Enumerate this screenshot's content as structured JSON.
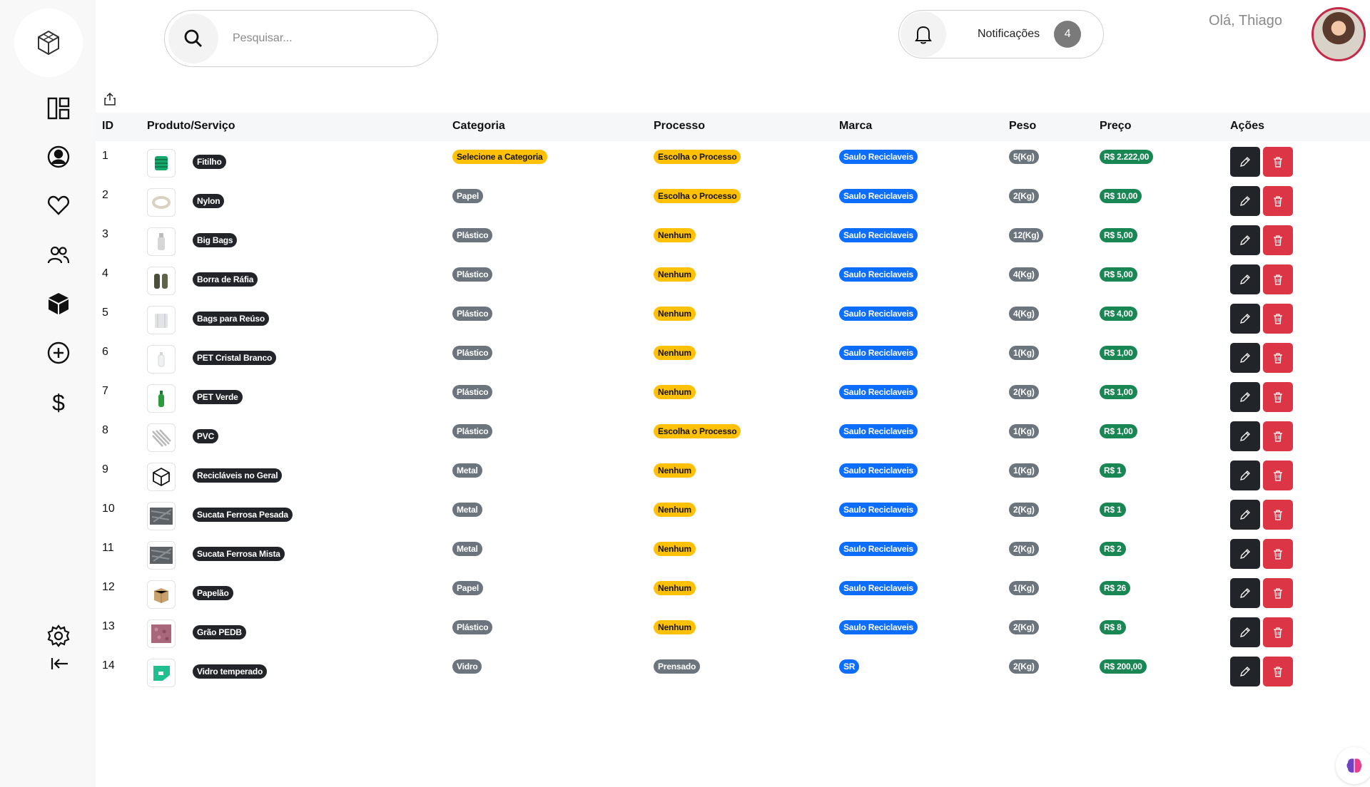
{
  "header": {
    "search_placeholder": "Pesquisar...",
    "notifications_label": "Notificações",
    "notifications_count": "4",
    "greeting": "Olá, Thiago"
  },
  "sidebar": {
    "items": [
      {
        "icon": "dashboard-icon"
      },
      {
        "icon": "user-circle-icon"
      },
      {
        "icon": "heart-icon"
      },
      {
        "icon": "users-icon"
      },
      {
        "icon": "box-icon"
      },
      {
        "icon": "plus-circle-icon"
      },
      {
        "icon": "dollar-icon"
      }
    ],
    "bottom": [
      {
        "icon": "gear-icon"
      },
      {
        "icon": "collapse-icon"
      }
    ]
  },
  "table": {
    "headers": {
      "id": "ID",
      "product": "Produto/Serviço",
      "category": "Categoria",
      "process": "Processo",
      "brand": "Marca",
      "weight": "Peso",
      "price": "Preço",
      "actions": "Ações"
    },
    "rows": [
      {
        "id": "1",
        "name": "Fitilho",
        "thumb": "spool",
        "category": "Selecione a Categoria",
        "category_style": "yellow",
        "process": "Escolha o Processo",
        "process_style": "yellow",
        "brand": "Saulo Reciclaveis",
        "weight": "5(Kg)",
        "price": "R$ 2.222,00"
      },
      {
        "id": "2",
        "name": "Nylon",
        "thumb": "ring",
        "category": "Papel",
        "category_style": "gray",
        "process": "Escolha o Processo",
        "process_style": "yellow",
        "brand": "Saulo Reciclaveis",
        "weight": "2(Kg)",
        "price": "R$ 10,00"
      },
      {
        "id": "3",
        "name": "Big Bags",
        "thumb": "bottle-white",
        "category": "Plástico",
        "category_style": "gray",
        "process": "Nenhum",
        "process_style": "yellow",
        "brand": "Saulo Reciclaveis",
        "weight": "12(Kg)",
        "price": "R$ 5,00"
      },
      {
        "id": "4",
        "name": "Borra de Ráfia",
        "thumb": "rolls",
        "category": "Plástico",
        "category_style": "gray",
        "process": "Nenhum",
        "process_style": "yellow",
        "brand": "Saulo Reciclaveis",
        "weight": "4(Kg)",
        "price": "R$ 5,00"
      },
      {
        "id": "5",
        "name": "Bags para Reúso",
        "thumb": "bag",
        "category": "Plástico",
        "category_style": "gray",
        "process": "Nenhum",
        "process_style": "yellow",
        "brand": "Saulo Reciclaveis",
        "weight": "4(Kg)",
        "price": "R$ 4,00"
      },
      {
        "id": "6",
        "name": "PET Cristal Branco",
        "thumb": "bottle-clear",
        "category": "Plástico",
        "category_style": "gray",
        "process": "Nenhum",
        "process_style": "yellow",
        "brand": "Saulo Reciclaveis",
        "weight": "1(Kg)",
        "price": "R$ 1,00"
      },
      {
        "id": "7",
        "name": "PET Verde",
        "thumb": "bottle-green",
        "category": "Plástico",
        "category_style": "gray",
        "process": "Nenhum",
        "process_style": "yellow",
        "brand": "Saulo Reciclaveis",
        "weight": "2(Kg)",
        "price": "R$ 1,00"
      },
      {
        "id": "8",
        "name": "PVC",
        "thumb": "pipes",
        "category": "Plástico",
        "category_style": "gray",
        "process": "Escolha o Processo",
        "process_style": "yellow",
        "brand": "Saulo Reciclaveis",
        "weight": "1(Kg)",
        "price": "R$ 1,00"
      },
      {
        "id": "9",
        "name": "Recicláveis no Geral",
        "thumb": "box-outline",
        "category": "Metal",
        "category_style": "gray",
        "process": "Nenhum",
        "process_style": "yellow",
        "brand": "Saulo Reciclaveis",
        "weight": "1(Kg)",
        "price": "R$ 1"
      },
      {
        "id": "10",
        "name": "Sucata Ferrosa Pesada",
        "thumb": "scrap",
        "category": "Metal",
        "category_style": "gray",
        "process": "Nenhum",
        "process_style": "yellow",
        "brand": "Saulo Reciclaveis",
        "weight": "2(Kg)",
        "price": "R$ 1"
      },
      {
        "id": "11",
        "name": "Sucata Ferrosa Mista",
        "thumb": "scrap",
        "category": "Metal",
        "category_style": "gray",
        "process": "Nenhum",
        "process_style": "yellow",
        "brand": "Saulo Reciclaveis",
        "weight": "2(Kg)",
        "price": "R$ 2"
      },
      {
        "id": "12",
        "name": "Papelão",
        "thumb": "cardboard",
        "category": "Papel",
        "category_style": "gray",
        "process": "Nenhum",
        "process_style": "yellow",
        "brand": "Saulo Reciclaveis",
        "weight": "1(Kg)",
        "price": "R$ 26"
      },
      {
        "id": "13",
        "name": "Grão PEDB",
        "thumb": "granules",
        "category": "Plástico",
        "category_style": "gray",
        "process": "Nenhum",
        "process_style": "yellow",
        "brand": "Saulo Reciclaveis",
        "weight": "2(Kg)",
        "price": "R$ 8"
      },
      {
        "id": "14",
        "name": "Vidro temperado",
        "thumb": "glass",
        "category": "Vidro",
        "category_style": "gray",
        "process": "Prensado",
        "process_style": "gray",
        "brand": "SR",
        "weight": "2(Kg)",
        "price": "R$ 200,00"
      }
    ]
  },
  "colors": {
    "yellow": "#ffc107",
    "gray": "#6c757d",
    "blue": "#0d6efd",
    "green": "#198754",
    "dark": "#212529",
    "red": "#dc3545"
  }
}
